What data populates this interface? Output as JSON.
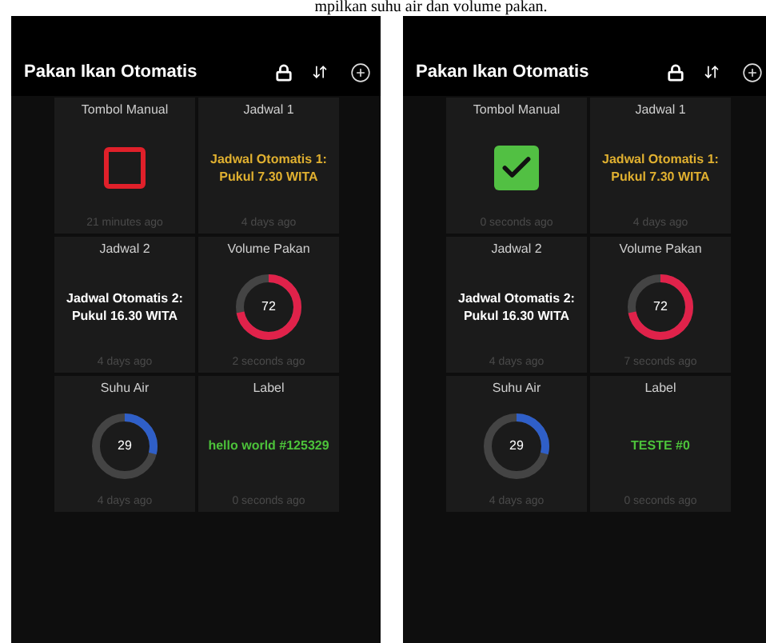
{
  "caption": "mpilkan suhu air dan volume pakan.",
  "phones": [
    {
      "title": "Pakan Ikan Otomatis",
      "tiles": [
        {
          "kind": "switch",
          "label": "Tombol Manual",
          "checked": false,
          "time": "21 minutes ago"
        },
        {
          "kind": "text",
          "label": "Jadwal 1",
          "value": "Jadwal Otomatis 1: Pukul 7.30 WITA",
          "color": "#e0b030",
          "time": "4 days ago"
        },
        {
          "kind": "text",
          "label": "Jadwal 2",
          "value": "Jadwal Otomatis 2: Pukul 16.30 WITA",
          "color": "#ffffff",
          "time": "4 days ago"
        },
        {
          "kind": "gauge",
          "label": "Volume Pakan",
          "value": "72",
          "level": 0.72,
          "color": "#e0224a",
          "time": "2 seconds ago"
        },
        {
          "kind": "gauge",
          "label": "Suhu Air",
          "value": "29",
          "level": 0.29,
          "color": "#2f5fc8",
          "time": "4 days ago"
        },
        {
          "kind": "text",
          "label": "Label",
          "value": "hello world #125329",
          "color": "#4cc23a",
          "time": "0 seconds ago"
        }
      ]
    },
    {
      "title": "Pakan Ikan Otomatis",
      "tiles": [
        {
          "kind": "switch",
          "label": "Tombol Manual",
          "checked": true,
          "time": "0 seconds ago"
        },
        {
          "kind": "text",
          "label": "Jadwal 1",
          "value": "Jadwal Otomatis 1: Pukul 7.30 WITA",
          "color": "#e0b030",
          "time": "4 days ago"
        },
        {
          "kind": "text",
          "label": "Jadwal 2",
          "value": "Jadwal Otomatis 2: Pukul 16.30 WITA",
          "color": "#ffffff",
          "time": "4 days ago"
        },
        {
          "kind": "gauge",
          "label": "Volume Pakan",
          "value": "72",
          "level": 0.72,
          "color": "#e0224a",
          "time": "7 seconds ago"
        },
        {
          "kind": "gauge",
          "label": "Suhu Air",
          "value": "29",
          "level": 0.29,
          "color": "#2f5fc8",
          "time": "4 days ago"
        },
        {
          "kind": "text",
          "label": "Label",
          "value": "TESTE #0",
          "color": "#4cc23a",
          "time": "0 seconds ago"
        }
      ]
    }
  ]
}
